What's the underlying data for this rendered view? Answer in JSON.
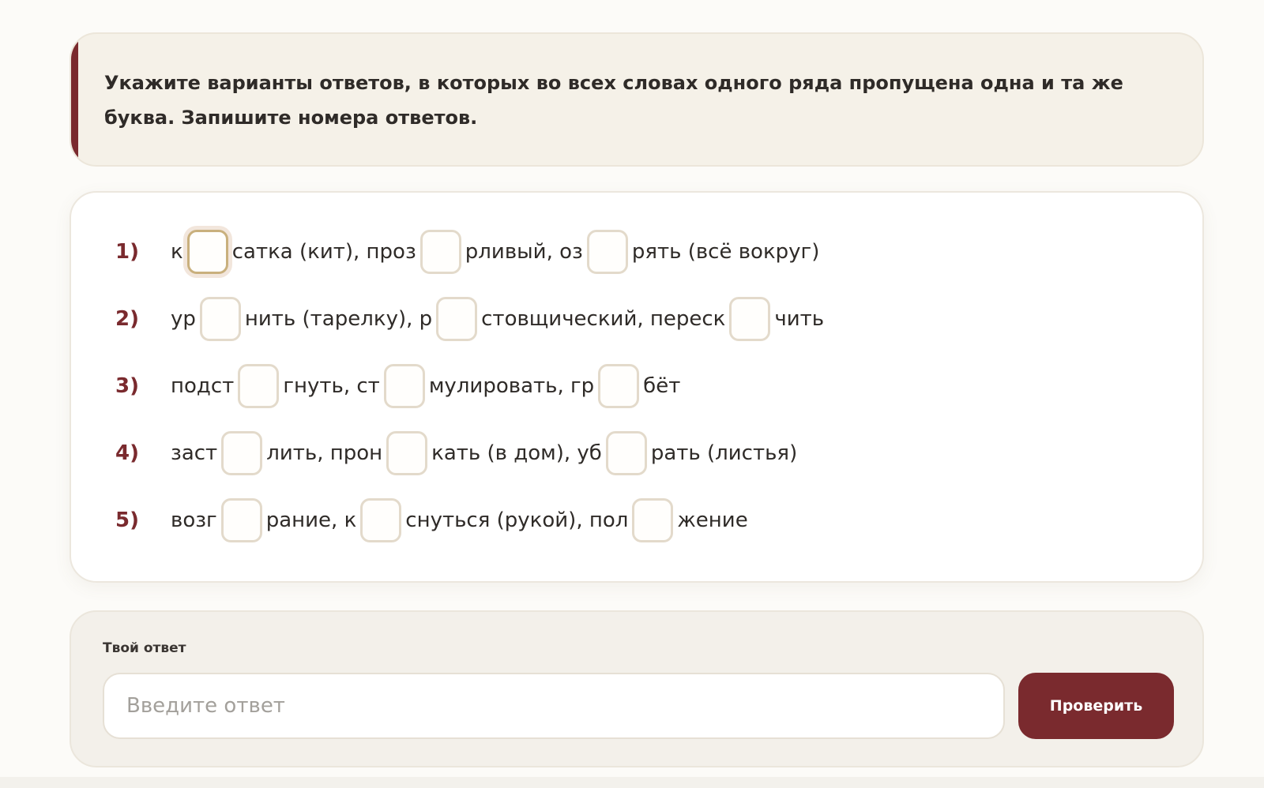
{
  "task": {
    "text": "Укажите варианты ответов, в которых во всех словах одного ряда пропущена одна и та же буква. Запишите номера ответов."
  },
  "colors": {
    "accent": "#7a2a2e",
    "card_background": "#f5f1e8",
    "page_background": "#fcfbf8"
  },
  "options": [
    {
      "number": "1)",
      "fragments": [
        "к",
        "сатка (кит), проз",
        "рливый, оз",
        "рять (всё вокруг)"
      ]
    },
    {
      "number": "2)",
      "fragments": [
        "ур",
        "нить (тарелку), р",
        "стовщический, переск",
        "чить"
      ]
    },
    {
      "number": "3)",
      "fragments": [
        "подст",
        "гнуть, ст",
        "мулировать, гр",
        "бёт"
      ]
    },
    {
      "number": "4)",
      "fragments": [
        "заст",
        "лить, прон",
        "кать (в дом), уб",
        "рать (листья)"
      ]
    },
    {
      "number": "5)",
      "fragments": [
        "возг",
        "рание, к",
        "снуться (рукой), пол",
        "жение"
      ]
    }
  ],
  "answer": {
    "label": "Твой ответ",
    "placeholder": "Введите ответ",
    "value": "",
    "submit_label": "Проверить"
  }
}
